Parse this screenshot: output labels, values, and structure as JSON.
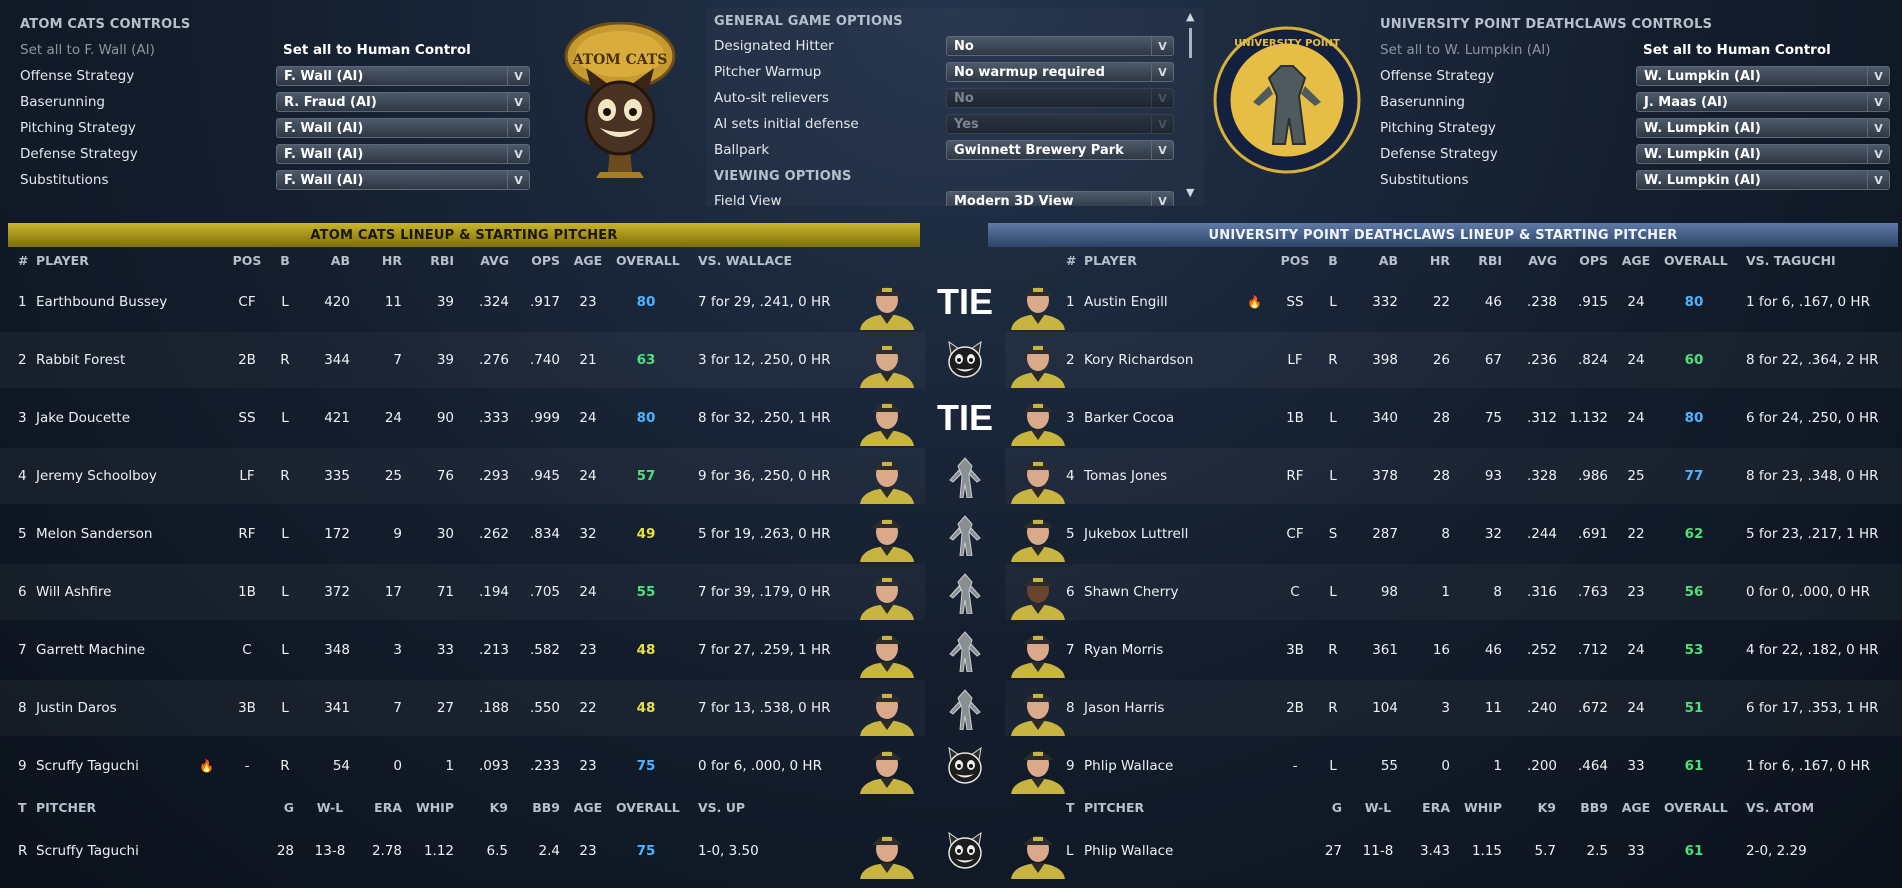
{
  "left_controls": {
    "title": "ATOM CATS CONTROLS",
    "set_all_ai": "Set all to F. Wall (AI)",
    "set_all_human": "Set all to Human Control",
    "rows": [
      {
        "label": "Offense Strategy",
        "value": "F. Wall (AI)"
      },
      {
        "label": "Baserunning",
        "value": "R. Fraud (AI)"
      },
      {
        "label": "Pitching Strategy",
        "value": "F. Wall (AI)"
      },
      {
        "label": "Defense Strategy",
        "value": "F. Wall (AI)"
      },
      {
        "label": "Substitutions",
        "value": "F. Wall (AI)"
      }
    ]
  },
  "left_logo_text": "ATOM CATS",
  "general": {
    "title": "GENERAL GAME OPTIONS",
    "rows": [
      {
        "label": "Designated Hitter",
        "value": "No",
        "disabled": false
      },
      {
        "label": "Pitcher Warmup",
        "value": "No warmup required",
        "disabled": false
      },
      {
        "label": "Auto-sit relievers",
        "value": "No",
        "disabled": true
      },
      {
        "label": "AI sets initial defense",
        "value": "Yes",
        "disabled": true
      },
      {
        "label": "Ballpark",
        "value": "Gwinnett Brewery Park",
        "disabled": false
      }
    ],
    "viewing_title": "VIEWING OPTIONS",
    "field_view_label": "Field View",
    "field_view_value": "Modern 3D View"
  },
  "right_logo_text": "UNIVERSITY POINT",
  "right_controls": {
    "title": "UNIVERSITY POINT DEATHCLAWS CONTROLS",
    "set_all_ai": "Set all to W. Lumpkin (AI)",
    "set_all_human": "Set all to Human Control",
    "rows": [
      {
        "label": "Offense Strategy",
        "value": "W. Lumpkin (AI)"
      },
      {
        "label": "Baserunning",
        "value": "J. Maas (AI)"
      },
      {
        "label": "Pitching Strategy",
        "value": "W. Lumpkin (AI)"
      },
      {
        "label": "Defense Strategy",
        "value": "W. Lumpkin (AI)"
      },
      {
        "label": "Substitutions",
        "value": "W. Lumpkin (AI)"
      }
    ]
  },
  "left_lineup": {
    "title": "ATOM CATS LINEUP & STARTING PITCHER",
    "headers": {
      "num": "#",
      "player": "PLAYER",
      "pos": "POS",
      "b": "B",
      "ab": "AB",
      "hr": "HR",
      "rbi": "RBI",
      "avg": "AVG",
      "ops": "OPS",
      "age": "AGE",
      "overall": "OVERALL",
      "vs": "VS. WALLACE"
    },
    "players": [
      {
        "num": "1",
        "name": "Earthbound Bussey",
        "pos": "CF",
        "b": "L",
        "ab": "420",
        "hr": "11",
        "rbi": "39",
        "avg": ".324",
        "ops": ".917",
        "age": "23",
        "overall": "80",
        "vs": "7 for 29, .241, 0 HR",
        "hot": false
      },
      {
        "num": "2",
        "name": "Rabbit Forest",
        "pos": "2B",
        "b": "R",
        "ab": "344",
        "hr": "7",
        "rbi": "39",
        "avg": ".276",
        "ops": ".740",
        "age": "21",
        "overall": "63",
        "vs": "3 for 12, .250, 0 HR",
        "hot": false
      },
      {
        "num": "3",
        "name": "Jake Doucette",
        "pos": "SS",
        "b": "L",
        "ab": "421",
        "hr": "24",
        "rbi": "90",
        "avg": ".333",
        "ops": ".999",
        "age": "24",
        "overall": "80",
        "vs": "8 for 32, .250, 1 HR",
        "hot": false
      },
      {
        "num": "4",
        "name": "Jeremy Schoolboy",
        "pos": "LF",
        "b": "R",
        "ab": "335",
        "hr": "25",
        "rbi": "76",
        "avg": ".293",
        "ops": ".945",
        "age": "24",
        "overall": "57",
        "vs": "9 for 36, .250, 0 HR",
        "hot": false
      },
      {
        "num": "5",
        "name": "Melon Sanderson",
        "pos": "RF",
        "b": "L",
        "ab": "172",
        "hr": "9",
        "rbi": "30",
        "avg": ".262",
        "ops": ".834",
        "age": "32",
        "overall": "49",
        "vs": "5 for 19, .263, 0 HR",
        "hot": false
      },
      {
        "num": "6",
        "name": "Will Ashfire",
        "pos": "1B",
        "b": "L",
        "ab": "372",
        "hr": "17",
        "rbi": "71",
        "avg": ".194",
        "ops": ".705",
        "age": "24",
        "overall": "55",
        "vs": "7 for 39, .179, 0 HR",
        "hot": false
      },
      {
        "num": "7",
        "name": "Garrett Machine",
        "pos": "C",
        "b": "L",
        "ab": "348",
        "hr": "3",
        "rbi": "33",
        "avg": ".213",
        "ops": ".582",
        "age": "23",
        "overall": "48",
        "vs": "7 for 27, .259, 1 HR",
        "hot": false
      },
      {
        "num": "8",
        "name": "Justin Daros",
        "pos": "3B",
        "b": "L",
        "ab": "341",
        "hr": "7",
        "rbi": "27",
        "avg": ".188",
        "ops": ".550",
        "age": "22",
        "overall": "48",
        "vs": "7 for 13, .538, 0 HR",
        "hot": false
      },
      {
        "num": "9",
        "name": "Scruffy Taguchi",
        "pos": "-",
        "b": "R",
        "ab": "54",
        "hr": "0",
        "rbi": "1",
        "avg": ".093",
        "ops": ".233",
        "age": "23",
        "overall": "75",
        "vs": "0 for 6, .000, 0 HR",
        "hot": true
      }
    ],
    "pitcher_headers": {
      "t": "T",
      "pitcher": "PITCHER",
      "g": "G",
      "wl": "W-L",
      "era": "ERA",
      "whip": "WHIP",
      "k9": "K9",
      "bb9": "BB9",
      "age": "AGE",
      "overall": "OVERALL",
      "vs": "VS. UP"
    },
    "pitcher": {
      "t": "R",
      "name": "Scruffy Taguchi",
      "g": "28",
      "wl": "13-8",
      "era": "2.78",
      "whip": "1.12",
      "k9": "6.5",
      "bb9": "2.4",
      "age": "23",
      "overall": "75",
      "vs": "1-0, 3.50"
    }
  },
  "right_lineup": {
    "title": "UNIVERSITY POINT DEATHCLAWS LINEUP & STARTING PITCHER",
    "headers": {
      "num": "#",
      "player": "PLAYER",
      "pos": "POS",
      "b": "B",
      "ab": "AB",
      "hr": "HR",
      "rbi": "RBI",
      "avg": "AVG",
      "ops": "OPS",
      "age": "AGE",
      "overall": "OVERALL",
      "vs": "VS. TAGUCHI"
    },
    "players": [
      {
        "num": "1",
        "name": "Austin Engill",
        "pos": "SS",
        "b": "L",
        "ab": "332",
        "hr": "22",
        "rbi": "46",
        "avg": ".238",
        "ops": ".915",
        "age": "24",
        "overall": "80",
        "vs": "1 for 6, .167, 0 HR",
        "hot": true
      },
      {
        "num": "2",
        "name": "Kory Richardson",
        "pos": "LF",
        "b": "R",
        "ab": "398",
        "hr": "26",
        "rbi": "67",
        "avg": ".236",
        "ops": ".824",
        "age": "24",
        "overall": "60",
        "vs": "8 for 22, .364, 2 HR",
        "hot": false
      },
      {
        "num": "3",
        "name": "Barker Cocoa",
        "pos": "1B",
        "b": "L",
        "ab": "340",
        "hr": "28",
        "rbi": "75",
        "avg": ".312",
        "ops": "1.132",
        "age": "24",
        "overall": "80",
        "vs": "6 for 24, .250, 0 HR",
        "hot": false
      },
      {
        "num": "4",
        "name": "Tomas Jones",
        "pos": "RF",
        "b": "L",
        "ab": "378",
        "hr": "28",
        "rbi": "93",
        "avg": ".328",
        "ops": ".986",
        "age": "25",
        "overall": "77",
        "vs": "8 for 23, .348, 0 HR",
        "hot": false
      },
      {
        "num": "5",
        "name": "Jukebox Luttrell",
        "pos": "CF",
        "b": "S",
        "ab": "287",
        "hr": "8",
        "rbi": "32",
        "avg": ".244",
        "ops": ".691",
        "age": "22",
        "overall": "62",
        "vs": "5 for 23, .217, 1 HR",
        "hot": false
      },
      {
        "num": "6",
        "name": "Shawn Cherry",
        "pos": "C",
        "b": "L",
        "ab": "98",
        "hr": "1",
        "rbi": "8",
        "avg": ".316",
        "ops": ".763",
        "age": "23",
        "overall": "56",
        "vs": "0 for 0, .000, 0 HR",
        "hot": false
      },
      {
        "num": "7",
        "name": "Ryan Morris",
        "pos": "3B",
        "b": "R",
        "ab": "361",
        "hr": "16",
        "rbi": "46",
        "avg": ".252",
        "ops": ".712",
        "age": "24",
        "overall": "53",
        "vs": "4 for 22, .182, 0 HR",
        "hot": false
      },
      {
        "num": "8",
        "name": "Jason Harris",
        "pos": "2B",
        "b": "R",
        "ab": "104",
        "hr": "3",
        "rbi": "11",
        "avg": ".240",
        "ops": ".672",
        "age": "24",
        "overall": "51",
        "vs": "6 for 17, .353, 1 HR",
        "hot": false
      },
      {
        "num": "9",
        "name": "Phlip Wallace",
        "pos": "-",
        "b": "L",
        "ab": "55",
        "hr": "0",
        "rbi": "1",
        "avg": ".200",
        "ops": ".464",
        "age": "33",
        "overall": "61",
        "vs": "1 for 6, .167, 0 HR",
        "hot": false
      }
    ],
    "pitcher_headers": {
      "t": "T",
      "pitcher": "PITCHER",
      "g": "G",
      "wl": "W-L",
      "era": "ERA",
      "whip": "WHIP",
      "k9": "K9",
      "bb9": "BB9",
      "age": "AGE",
      "overall": "OVERALL",
      "vs": "VS. ATOM"
    },
    "pitcher": {
      "t": "L",
      "name": "Phlip Wallace",
      "g": "27",
      "wl": "11-8",
      "era": "3.43",
      "whip": "1.15",
      "k9": "5.7",
      "bb9": "2.5",
      "age": "33",
      "overall": "61",
      "vs": "2-0, 2.29"
    }
  },
  "matchups": [
    {
      "kind": "tie",
      "text": "TIE"
    },
    {
      "kind": "cat"
    },
    {
      "kind": "tie",
      "text": "TIE"
    },
    {
      "kind": "claw"
    },
    {
      "kind": "claw"
    },
    {
      "kind": "claw"
    },
    {
      "kind": "claw"
    },
    {
      "kind": "claw"
    },
    {
      "kind": "cat"
    }
  ],
  "pitcher_matchup": {
    "kind": "cat"
  },
  "colors": {
    "left_bar": "#a39212",
    "right_bar": "#3f5b86",
    "ovr_high": "#4fb3ff",
    "ovr_good": "#4fe07a",
    "ovr_avg": "#e8e044"
  }
}
